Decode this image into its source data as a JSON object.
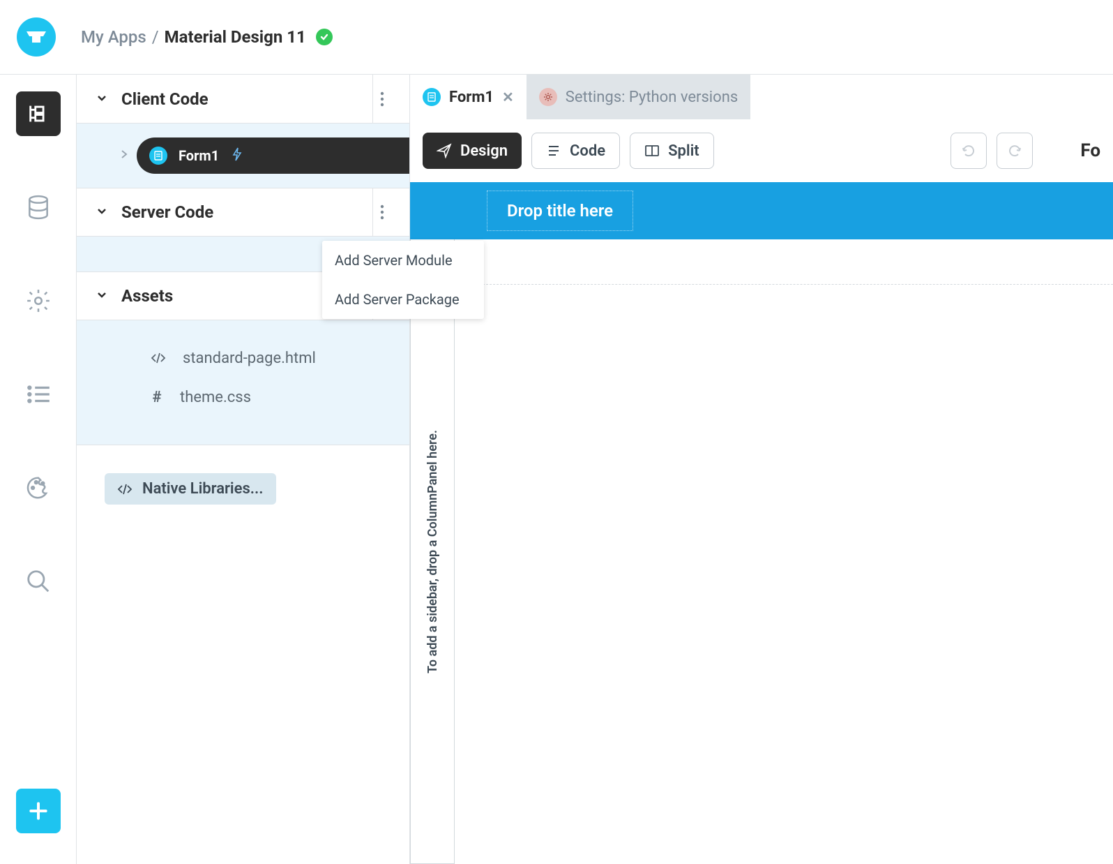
{
  "breadcrumb": {
    "parent": "My Apps",
    "sep": "/",
    "current": "Material Design 11"
  },
  "sidebar": {
    "sections": {
      "client": {
        "title": "Client Code",
        "form": "Form1"
      },
      "server": {
        "title": "Server Code"
      },
      "assets": {
        "title": "Assets",
        "items": [
          "standard-page.html",
          "theme.css"
        ]
      },
      "native": "Native Libraries..."
    }
  },
  "popup": {
    "items": [
      "Add Server Module",
      "Add Server Package"
    ]
  },
  "tabs": [
    {
      "label": "Form1"
    },
    {
      "label": "Settings: Python versions"
    }
  ],
  "toolbar": {
    "design": "Design",
    "code": "Code",
    "split": "Split"
  },
  "canvas": {
    "drop_title": "Drop title here",
    "sidebar_hint": "To add a sidebar, drop a ColumnPanel here."
  },
  "form_label_right": "Fo"
}
